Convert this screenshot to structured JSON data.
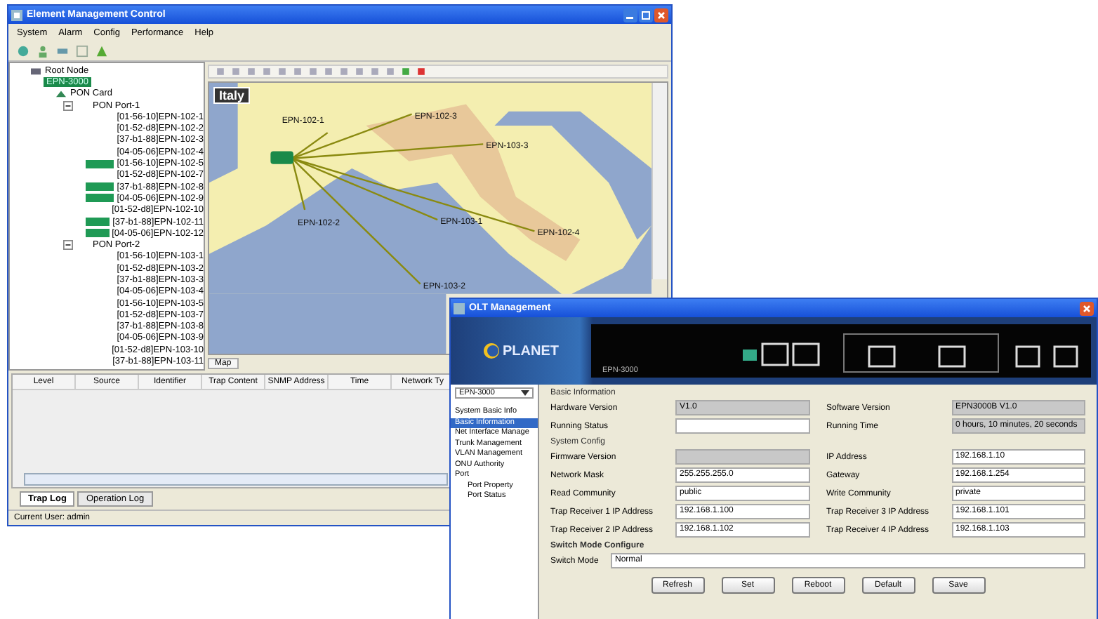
{
  "main_window": {
    "title": "Element Management Control",
    "menu": [
      "System",
      "Alarm",
      "Config",
      "Performance",
      "Help"
    ]
  },
  "tree": {
    "root": {
      "label": "Root Node",
      "selected": false
    },
    "device": {
      "label": "EPN-3000",
      "selected": true
    },
    "card": {
      "label": "PON Card",
      "selected": false
    },
    "ports": [
      {
        "label": "PON Port-1",
        "expanded": true,
        "children": [
          {
            "label": "[01-56-10]EPN-102-1",
            "flagged": false
          },
          {
            "label": "[01-52-d8]EPN-102-2",
            "flagged": false
          },
          {
            "label": "[37-b1-88]EPN-102-3",
            "flagged": false
          },
          {
            "label": "[04-05-06]EPN-102-4",
            "flagged": false
          },
          {
            "label": "[01-56-10]EPN-102-5",
            "flagged": true
          },
          {
            "label": "[01-52-d8]EPN-102-7",
            "flagged": false
          },
          {
            "label": "[37-b1-88]EPN-102-8",
            "flagged": true
          },
          {
            "label": "[04-05-06]EPN-102-9",
            "flagged": true
          },
          {
            "label": "[01-52-d8]EPN-102-10",
            "flagged": false
          },
          {
            "label": "[37-b1-88]EPN-102-11",
            "flagged": true
          },
          {
            "label": "[04-05-06]EPN-102-12",
            "flagged": true
          }
        ]
      },
      {
        "label": "PON Port-2",
        "expanded": true,
        "children": [
          {
            "label": "[01-56-10]EPN-103-1",
            "flagged": false
          },
          {
            "label": "[01-52-d8]EPN-103-2",
            "flagged": false
          },
          {
            "label": "[37-b1-88]EPN-103-3",
            "flagged": false
          },
          {
            "label": "[04-05-06]EPN-103-4",
            "flagged": false
          },
          {
            "label": "[01-56-10]EPN-103-5",
            "flagged": false
          },
          {
            "label": "[01-52-d8]EPN-103-7",
            "flagged": false
          },
          {
            "label": "[37-b1-88]EPN-103-8",
            "flagged": false
          },
          {
            "label": "[04-05-06]EPN-103-9",
            "flagged": false
          },
          {
            "label": "[01-52-d8]EPN-103-10",
            "flagged": false
          },
          {
            "label": "[37-b1-88]EPN-103-11",
            "flagged": false
          }
        ]
      }
    ]
  },
  "map": {
    "title": "Italy",
    "links": [
      {
        "label": "EPN-102-1"
      },
      {
        "label": "EPN-102-3"
      },
      {
        "label": "EPN-103-3"
      },
      {
        "label": "EPN-102-2"
      },
      {
        "label": "EPN-103-1"
      },
      {
        "label": "EPN-102-4"
      },
      {
        "label": "EPN-103-2"
      }
    ],
    "tab": "Map"
  },
  "event_table": {
    "columns": [
      "Level",
      "Source",
      "Identifier",
      "Trap Content",
      "SNMP Address",
      "Time",
      "Network Ty"
    ]
  },
  "log_tabs": [
    {
      "label": "Trap Log",
      "selected": true
    },
    {
      "label": "Operation Log",
      "selected": false
    }
  ],
  "status_bar": "Current User: admin",
  "olt_window": {
    "title": "OLT Management",
    "logo": "PLANET",
    "model": "EPN-3000",
    "nav_select": "EPN-3000",
    "nav": [
      {
        "label": "System Basic Info",
        "selected": false
      },
      {
        "label": "Basic Information",
        "selected": true
      },
      {
        "label": "Net Interface Manage",
        "selected": false
      },
      {
        "label": "Trunk Management",
        "selected": false
      },
      {
        "label": "VLAN Management",
        "selected": false
      },
      {
        "label": "ONU Authority",
        "selected": false
      },
      {
        "label": "Port",
        "selected": false,
        "children": [
          {
            "label": "Port Property",
            "selected": false
          },
          {
            "label": "Port Status",
            "selected": false
          }
        ]
      }
    ],
    "sections": [
      {
        "title": "Basic Information",
        "fields": [
          {
            "label": "Hardware Version",
            "value": "V1.0",
            "readonly": true
          },
          {
            "label": "Software Version",
            "value": "EPN3000B V1.0",
            "readonly": true
          },
          {
            "label": "Running Status",
            "readonly": false
          },
          {
            "label": "Running Time",
            "value": "0 hours, 10 minutes, 20 seconds",
            "readonly": true
          }
        ]
      },
      {
        "title": "System Config",
        "fields": [
          {
            "label": "Firmware Version",
            "readonly": true
          },
          {
            "label": "IP Address",
            "value": "192.168.1.10",
            "readonly": false
          },
          {
            "label": "Network Mask",
            "value": "255.255.255.0",
            "readonly": false
          },
          {
            "label": "Gateway",
            "value": "192.168.1.254",
            "readonly": false
          },
          {
            "label": "Read Community",
            "value": "public",
            "readonly": false
          },
          {
            "label": "Write Community",
            "value": "private",
            "readonly": false
          },
          {
            "label": "Trap Receiver 1 IP Address",
            "value": "192.168.1.100",
            "readonly": false
          },
          {
            "label": "Trap Receiver 3 IP Address",
            "value": "192.168.1.101",
            "readonly": false
          },
          {
            "label": "Trap Receiver 2 IP Address",
            "value": "192.168.1.102",
            "readonly": false
          },
          {
            "label": "Trap Receiver 4 IP Address",
            "value": "192.168.1.103",
            "readonly": false
          }
        ]
      }
    ],
    "switch_mode": {
      "title": "Switch Mode Configure",
      "label": "Switch Mode",
      "value": "Normal"
    },
    "buttons": [
      "Refresh",
      "Set",
      "Reboot",
      "Default",
      "Save"
    ]
  }
}
